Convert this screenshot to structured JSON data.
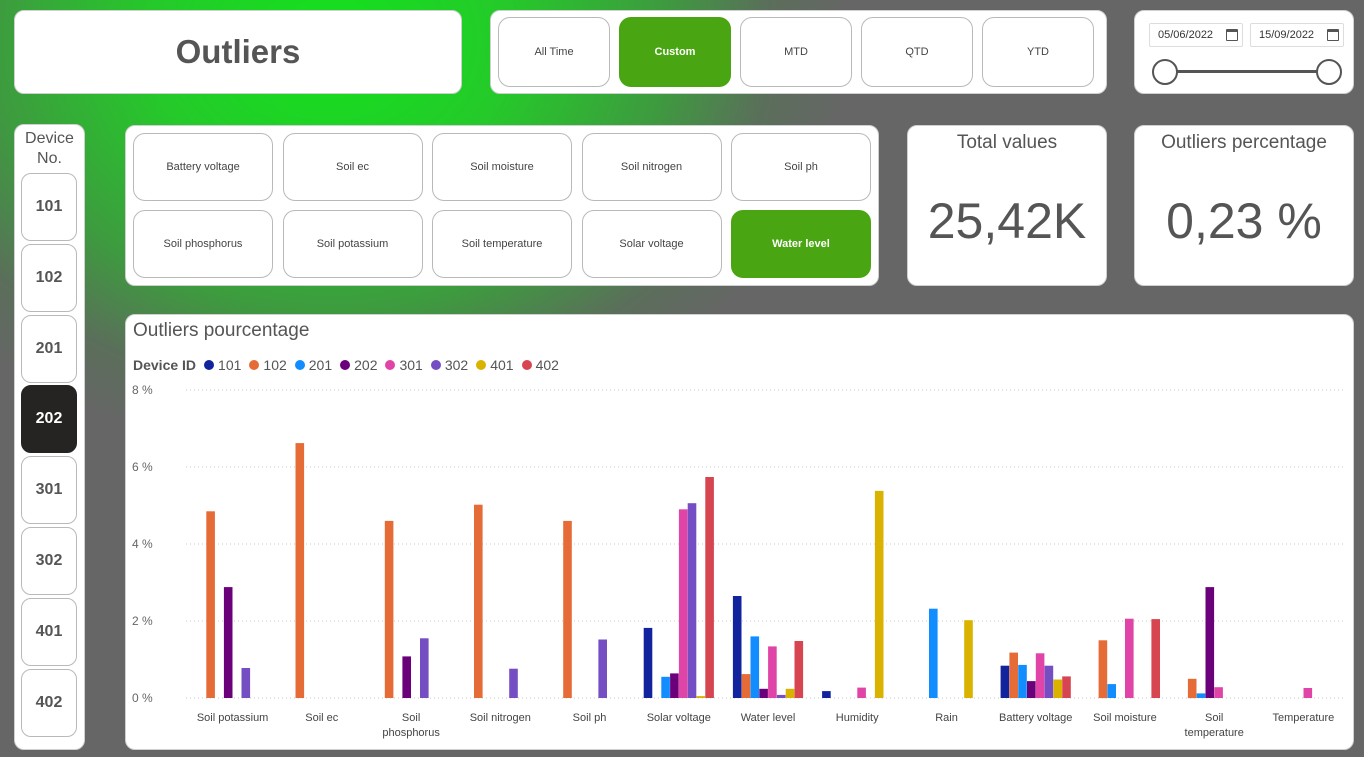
{
  "title": "Outliers",
  "period_buttons": [
    {
      "label": "All Time",
      "active": false
    },
    {
      "label": "Custom",
      "active": true
    },
    {
      "label": "MTD",
      "active": false
    },
    {
      "label": "QTD",
      "active": false
    },
    {
      "label": "YTD",
      "active": false
    }
  ],
  "date_range": {
    "start": "05/06/2022",
    "end": "15/09/2022",
    "icon": "calendar-icon"
  },
  "device_panel": {
    "header": "Device No.",
    "devices": [
      "101",
      "102",
      "201",
      "202",
      "301",
      "302",
      "401",
      "402"
    ],
    "selected": "202"
  },
  "metrics": {
    "buttons": [
      {
        "label": "Battery voltage",
        "active": false
      },
      {
        "label": "Soil ec",
        "active": false
      },
      {
        "label": "Soil moisture",
        "active": false
      },
      {
        "label": "Soil nitrogen",
        "active": false
      },
      {
        "label": "Soil ph",
        "active": false
      },
      {
        "label": "Soil phosphorus",
        "active": false
      },
      {
        "label": "Soil potassium",
        "active": false
      },
      {
        "label": "Soil temperature",
        "active": false
      },
      {
        "label": "Solar voltage",
        "active": false
      },
      {
        "label": "Water level",
        "active": true
      }
    ]
  },
  "kpis": {
    "total_title": "Total values",
    "total_value": "25,42K",
    "pct_title": "Outliers percentage",
    "pct_value": "0,23 %"
  },
  "colors": {
    "accent_green": "#49a511",
    "selected_dark": "#252423"
  },
  "chart_data": {
    "type": "bar",
    "title": "Outliers pourcentage",
    "legend_title": "Device ID",
    "legend_position": "top-left",
    "ylim": [
      0,
      8
    ],
    "yticks": [
      "0 %",
      "2 %",
      "4 %",
      "6 %",
      "8 %"
    ],
    "grid": true,
    "categories": [
      "Soil potassium",
      "Soil ec",
      "Soil phosphorus",
      "Soil nitrogen",
      "Soil ph",
      "Solar voltage",
      "Water level",
      "Humidity",
      "Rain",
      "Battery voltage",
      "Soil moisture",
      "Soil temperature",
      "Temperature"
    ],
    "series": [
      {
        "name": "101",
        "color": "#12239e",
        "values": [
          0,
          0,
          0,
          0,
          0,
          1.82,
          2.65,
          0.18,
          0,
          0.84,
          0,
          0,
          0
        ]
      },
      {
        "name": "102",
        "color": "#e66c37",
        "values": [
          4.85,
          6.62,
          4.6,
          5.02,
          4.6,
          0,
          0.62,
          0,
          0,
          1.18,
          1.5,
          0.5,
          0
        ]
      },
      {
        "name": "201",
        "color": "#118dff",
        "values": [
          0,
          0,
          0,
          0,
          0,
          0.55,
          1.6,
          0,
          2.32,
          0.86,
          0.36,
          0.12,
          0
        ]
      },
      {
        "name": "202",
        "color": "#6b007b",
        "values": [
          2.88,
          0,
          1.08,
          0,
          0,
          0.64,
          0.24,
          0,
          0,
          0.44,
          0,
          2.88,
          0
        ]
      },
      {
        "name": "301",
        "color": "#e044a7",
        "values": [
          0,
          0,
          0,
          0,
          0,
          4.9,
          1.34,
          0.27,
          0,
          1.16,
          2.06,
          0.28,
          0.26
        ]
      },
      {
        "name": "302",
        "color": "#744ec2",
        "values": [
          0.78,
          0,
          1.55,
          0.76,
          1.52,
          5.06,
          0.08,
          0,
          0,
          0.84,
          0,
          0,
          0
        ]
      },
      {
        "name": "401",
        "color": "#d9b300",
        "values": [
          0,
          0,
          0,
          0,
          0,
          0.05,
          0.24,
          5.38,
          2.02,
          0.48,
          0,
          0,
          0
        ]
      },
      {
        "name": "402",
        "color": "#d64550",
        "values": [
          0,
          0,
          0,
          0,
          0,
          5.74,
          1.48,
          0,
          0,
          0.56,
          2.05,
          0,
          0
        ]
      }
    ]
  }
}
